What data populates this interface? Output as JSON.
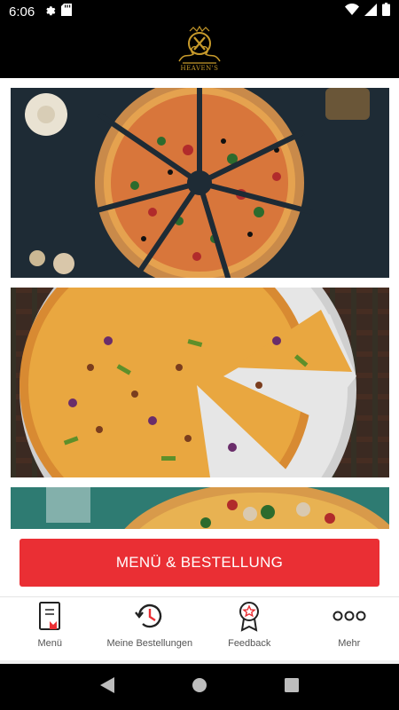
{
  "status_bar": {
    "time": "6:06",
    "icons_left": [
      "settings-icon",
      "sd-card-icon"
    ],
    "icons_right": [
      "wifi-icon",
      "cell-signal-icon",
      "battery-icon"
    ]
  },
  "header": {
    "logo_text": "HEAVEN'S",
    "logo_color": "#c79a2b"
  },
  "feed": {
    "cards": [
      {
        "name": "pizza-image-1",
        "description_icon": "pizza-image"
      },
      {
        "name": "pizza-image-2",
        "description_icon": "pizza-image"
      },
      {
        "name": "pizza-image-3",
        "description_icon": "pizza-image"
      }
    ]
  },
  "cta": {
    "label": "MENÜ & BESTELLUNG",
    "color": "#ea2f34"
  },
  "bottom_nav": {
    "items": [
      {
        "label": "Menü",
        "icon": "menu-book-icon"
      },
      {
        "label": "Meine Bestellungen",
        "icon": "history-icon"
      },
      {
        "label": "Feedback",
        "icon": "award-icon"
      },
      {
        "label": "Mehr",
        "icon": "more-icon"
      }
    ]
  },
  "system_nav": {
    "icons": [
      "back-icon",
      "home-icon",
      "recents-icon"
    ]
  }
}
